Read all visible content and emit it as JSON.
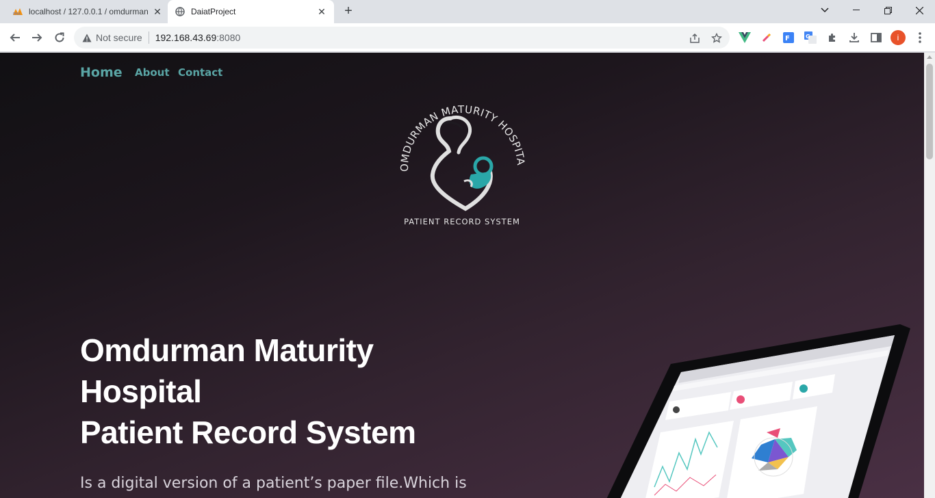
{
  "browser": {
    "tabs": [
      {
        "title": "localhost / 127.0.0.1 / omdurman",
        "active": false,
        "favicon": "phpmyadmin-icon"
      },
      {
        "title": "DaiatProject",
        "active": true,
        "favicon": "globe-icon"
      }
    ],
    "address": {
      "security_label": "Not secure",
      "host": "192.168.43.69",
      "port": ":8080"
    },
    "profile_initial": "i"
  },
  "site": {
    "nav": {
      "home": "Home",
      "about": "About",
      "contact": "Contact"
    },
    "logo": {
      "arc_text": "OMDURMAN MATURITY HOSPITAL",
      "subtitle": "PATIENT RECORD SYSTEM"
    },
    "hero": {
      "line1": "Omdurman Maturity",
      "line2": "Hospital",
      "line3": "Patient Record System"
    },
    "description": "Is a digital version of a patient’s paper file.Which is"
  },
  "colors": {
    "nav_link": "#5aa5a5",
    "logo_accent": "#2aa7a8"
  }
}
